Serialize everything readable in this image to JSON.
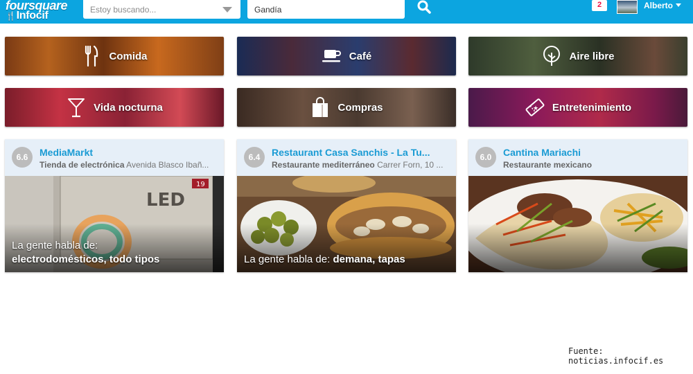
{
  "header": {
    "logo_line1": "foursquare",
    "logo_line2": "Infocif",
    "search_placeholder": "Estoy buscando...",
    "location_value": "Gandía",
    "notifications_count": "2",
    "user_name": "Alberto"
  },
  "categories": [
    {
      "label": "Comida",
      "icon": "fork-knife-icon"
    },
    {
      "label": "Café",
      "icon": "coffee-cup-icon"
    },
    {
      "label": "Aire libre",
      "icon": "tree-icon"
    },
    {
      "label": "Vida nocturna",
      "icon": "cocktail-icon"
    },
    {
      "label": "Compras",
      "icon": "shopping-bag-icon"
    },
    {
      "label": "Entretenimiento",
      "icon": "ticket-icon"
    }
  ],
  "venues": [
    {
      "rating": "6.6",
      "name": "MediaMarkt",
      "category": "Tienda de electrónica",
      "address": "Avenida Blasco Ibañ...",
      "talk_prefix": "La gente habla de:",
      "talk_topics": "electrodomésticos, todo tipos"
    },
    {
      "rating": "6.4",
      "name": "Restaurant Casa Sanchis - La Tu...",
      "category": "Restaurante mediterráneo",
      "address": "Carrer Forn, 10 ...",
      "talk_prefix": "La gente habla de:",
      "talk_topics": "demana, tapas"
    },
    {
      "rating": "6.0",
      "name": "Cantina Mariachi",
      "category": "Restaurante mexicano",
      "address": "",
      "talk_prefix": "",
      "talk_topics": ""
    }
  ],
  "photo_texts": {
    "led_sign": "LED",
    "led_number": "19"
  },
  "footer": {
    "source": "Fuente: noticias.infocif.es"
  }
}
